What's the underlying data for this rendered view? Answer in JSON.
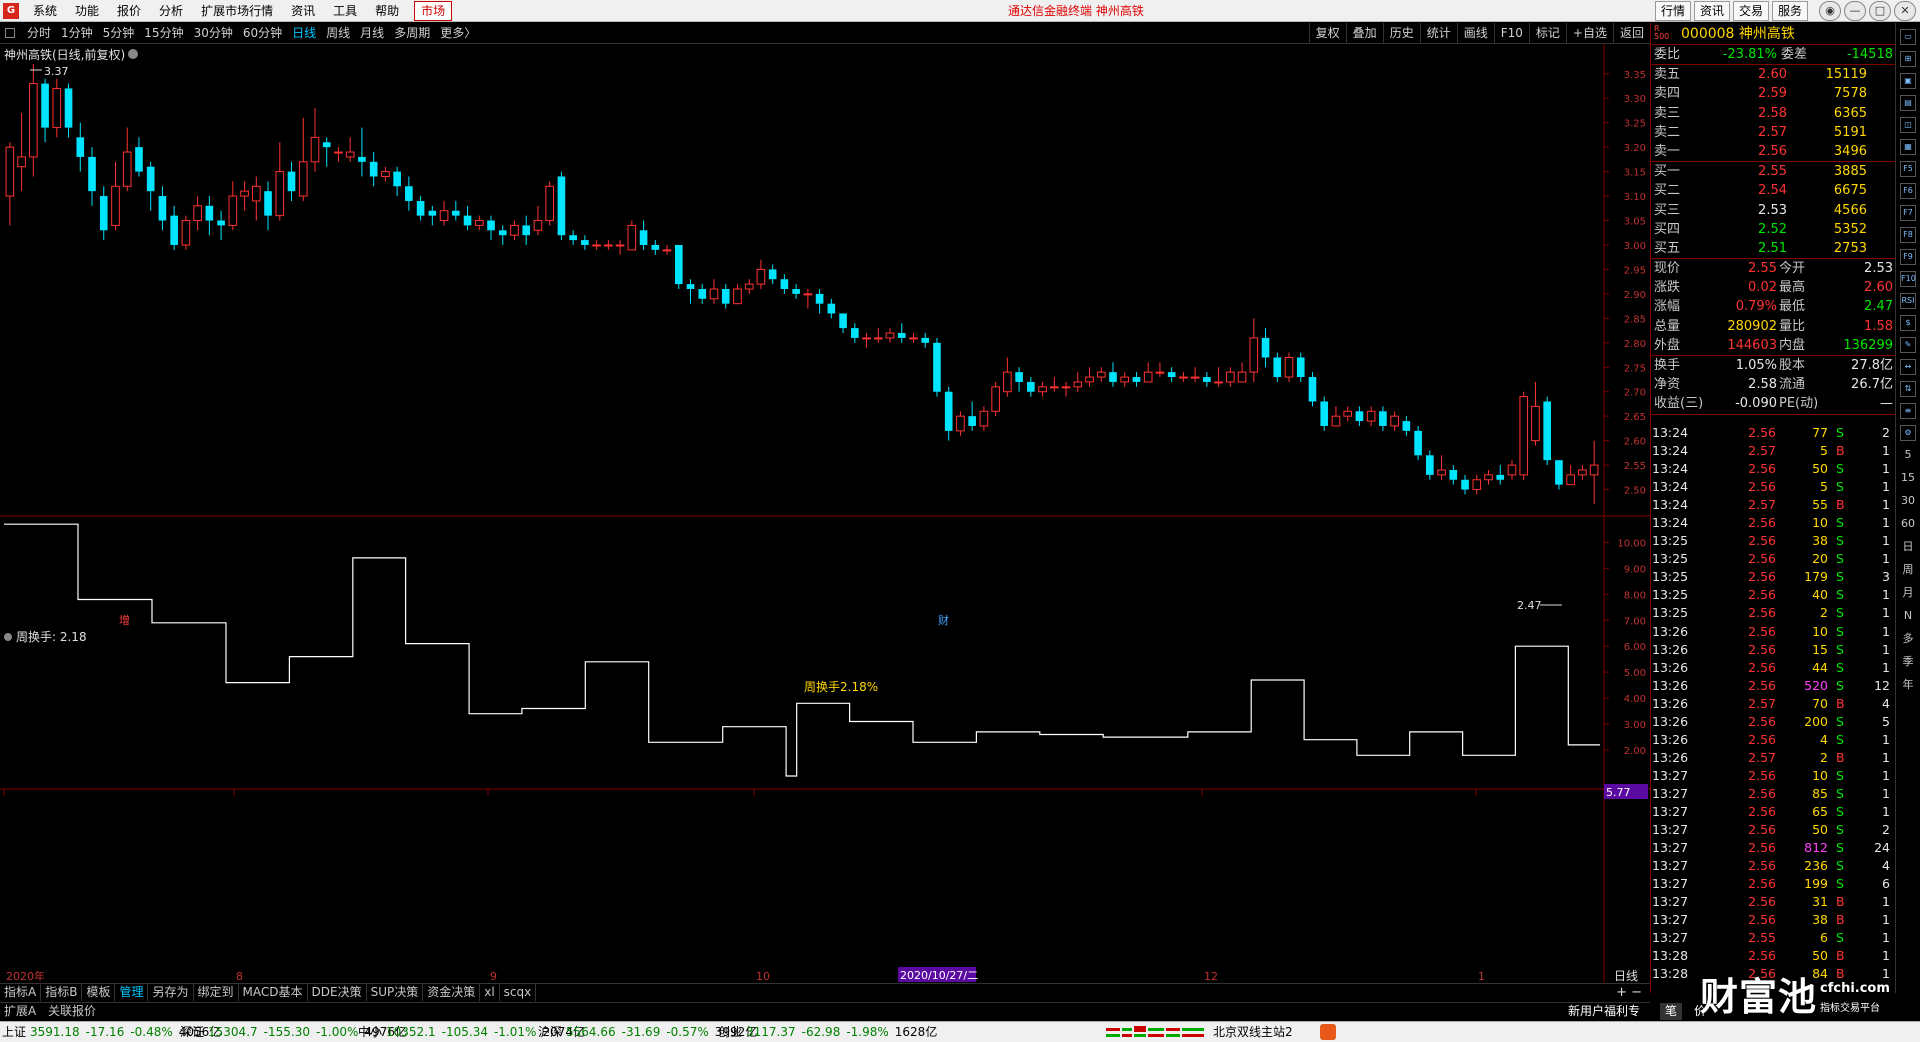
{
  "menu": {
    "logo_text": "G",
    "items": [
      "系统",
      "功能",
      "报价",
      "分析",
      "扩展市场行情",
      "资讯",
      "工具",
      "帮助"
    ],
    "market": "市场",
    "center_title": "通达信金融终端  神州高铁",
    "right_buttons": [
      "行情",
      "资讯",
      "交易",
      "服务"
    ],
    "win_buttons": [
      "◉",
      "—",
      "□",
      "✕"
    ]
  },
  "period": {
    "tabs": [
      "分时",
      "1分钟",
      "5分钟",
      "15分钟",
      "30分钟",
      "60分钟",
      "日线",
      "周线",
      "月线",
      "多周期",
      "更多〉"
    ],
    "active": "日线",
    "tools": [
      "复权",
      "叠加",
      "历史",
      "统计",
      "画线",
      "F10",
      "标记",
      "+自选",
      "返回"
    ]
  },
  "chart": {
    "title": "神州高铁(日线,前复权)",
    "y_ticks": [
      "3.35",
      "3.30",
      "3.25",
      "3.20",
      "3.15",
      "3.10",
      "3.05",
      "3.00",
      "2.95",
      "2.90",
      "2.85",
      "2.80",
      "2.75",
      "2.70",
      "2.65",
      "2.60",
      "2.55",
      "2.50"
    ],
    "high_label": "3.37",
    "low_label": "2.47",
    "marker_zeng": "增",
    "marker_cai": "财",
    "indicator_name": "周换手",
    "indicator_value_label": "周换手: 2.18",
    "indicator_center_text": "周换手2.18%",
    "ind_ticks": [
      "10.00",
      "9.00",
      "8.00",
      "7.00",
      "6.00",
      "5.00",
      "4.00",
      "3.00",
      "2.00"
    ],
    "ind_current": "5.77",
    "x_labels": [
      "2020年",
      "8",
      "9",
      "10",
      "12",
      "1"
    ],
    "x_cursor": "2020/10/27/二",
    "period_label": "日线"
  },
  "chart_data": {
    "type": "candlestick",
    "y_range": [
      2.45,
      3.37
    ],
    "candles": [
      [
        3.1,
        3.2,
        3.21,
        3.04
      ],
      [
        3.16,
        3.18,
        3.27,
        3.11
      ],
      [
        3.18,
        3.33,
        3.37,
        3.14
      ],
      [
        3.33,
        3.24,
        3.34,
        3.21
      ],
      [
        3.24,
        3.32,
        3.34,
        3.22
      ],
      [
        3.32,
        3.24,
        3.33,
        3.22
      ],
      [
        3.22,
        3.18,
        3.25,
        3.15
      ],
      [
        3.18,
        3.11,
        3.2,
        3.08
      ],
      [
        3.1,
        3.03,
        3.12,
        3.01
      ],
      [
        3.04,
        3.12,
        3.17,
        3.03
      ],
      [
        3.12,
        3.19,
        3.24,
        3.11
      ],
      [
        3.2,
        3.15,
        3.22,
        3.14
      ],
      [
        3.16,
        3.11,
        3.17,
        3.07
      ],
      [
        3.1,
        3.05,
        3.12,
        3.03
      ],
      [
        3.06,
        3.0,
        3.08,
        2.99
      ],
      [
        3.0,
        3.05,
        3.06,
        2.99
      ],
      [
        3.05,
        3.08,
        3.1,
        3.03
      ],
      [
        3.08,
        3.05,
        3.1,
        3.02
      ],
      [
        3.05,
        3.04,
        3.07,
        3.01
      ],
      [
        3.04,
        3.1,
        3.13,
        3.03
      ],
      [
        3.1,
        3.11,
        3.13,
        3.07
      ],
      [
        3.09,
        3.12,
        3.14,
        3.05
      ],
      [
        3.11,
        3.06,
        3.13,
        3.03
      ],
      [
        3.06,
        3.15,
        3.21,
        3.05
      ],
      [
        3.15,
        3.11,
        3.17,
        3.09
      ],
      [
        3.1,
        3.17,
        3.26,
        3.09
      ],
      [
        3.17,
        3.22,
        3.28,
        3.15
      ],
      [
        3.21,
        3.2,
        3.22,
        3.16
      ],
      [
        3.19,
        3.19,
        3.2,
        3.17
      ],
      [
        3.18,
        3.19,
        3.22,
        3.17
      ],
      [
        3.18,
        3.17,
        3.24,
        3.14
      ],
      [
        3.17,
        3.14,
        3.19,
        3.12
      ],
      [
        3.14,
        3.15,
        3.16,
        3.13
      ],
      [
        3.15,
        3.12,
        3.16,
        3.1
      ],
      [
        3.12,
        3.09,
        3.14,
        3.07
      ],
      [
        3.09,
        3.06,
        3.1,
        3.05
      ],
      [
        3.07,
        3.06,
        3.08,
        3.04
      ],
      [
        3.05,
        3.07,
        3.09,
        3.04
      ],
      [
        3.07,
        3.06,
        3.09,
        3.05
      ],
      [
        3.06,
        3.04,
        3.08,
        3.03
      ],
      [
        3.04,
        3.05,
        3.06,
        3.03
      ],
      [
        3.05,
        3.03,
        3.06,
        3.01
      ],
      [
        3.03,
        3.02,
        3.04,
        3.0
      ],
      [
        3.02,
        3.04,
        3.05,
        3.01
      ],
      [
        3.04,
        3.02,
        3.06,
        3.0
      ],
      [
        3.03,
        3.05,
        3.08,
        3.02
      ],
      [
        3.05,
        3.12,
        3.13,
        3.04
      ],
      [
        3.14,
        3.02,
        3.15,
        3.01
      ],
      [
        3.02,
        3.01,
        3.03,
        3.0
      ],
      [
        3.01,
        3.0,
        3.02,
        2.99
      ],
      [
        3.0,
        3.0,
        3.01,
        2.99
      ],
      [
        3.0,
        3.0,
        3.01,
        2.99
      ],
      [
        3.0,
        3.0,
        3.01,
        2.98
      ],
      [
        2.99,
        3.04,
        3.05,
        2.99
      ],
      [
        3.03,
        3.0,
        3.05,
        2.99
      ],
      [
        3.0,
        2.99,
        3.01,
        2.98
      ],
      [
        2.99,
        2.99,
        3.0,
        2.98
      ],
      [
        3.0,
        2.92,
        3.0,
        2.91
      ],
      [
        2.92,
        2.91,
        2.93,
        2.88
      ],
      [
        2.91,
        2.89,
        2.92,
        2.88
      ],
      [
        2.89,
        2.91,
        2.93,
        2.88
      ],
      [
        2.91,
        2.88,
        2.92,
        2.87
      ],
      [
        2.88,
        2.91,
        2.92,
        2.88
      ],
      [
        2.91,
        2.92,
        2.93,
        2.9
      ],
      [
        2.92,
        2.95,
        2.97,
        2.91
      ],
      [
        2.95,
        2.93,
        2.96,
        2.92
      ],
      [
        2.93,
        2.91,
        2.94,
        2.9
      ],
      [
        2.91,
        2.9,
        2.92,
        2.89
      ],
      [
        2.9,
        2.9,
        2.91,
        2.87
      ],
      [
        2.9,
        2.88,
        2.91,
        2.86
      ],
      [
        2.88,
        2.86,
        2.89,
        2.85
      ],
      [
        2.86,
        2.83,
        2.86,
        2.82
      ],
      [
        2.83,
        2.81,
        2.84,
        2.8
      ],
      [
        2.81,
        2.81,
        2.82,
        2.79
      ],
      [
        2.81,
        2.81,
        2.83,
        2.8
      ],
      [
        2.81,
        2.82,
        2.83,
        2.8
      ],
      [
        2.82,
        2.81,
        2.84,
        2.8
      ],
      [
        2.81,
        2.81,
        2.82,
        2.8
      ],
      [
        2.81,
        2.8,
        2.82,
        2.79
      ],
      [
        2.8,
        2.7,
        2.81,
        2.69
      ],
      [
        2.7,
        2.62,
        2.71,
        2.6
      ],
      [
        2.62,
        2.65,
        2.66,
        2.61
      ],
      [
        2.65,
        2.63,
        2.68,
        2.62
      ],
      [
        2.63,
        2.66,
        2.67,
        2.62
      ],
      [
        2.66,
        2.71,
        2.72,
        2.65
      ],
      [
        2.7,
        2.74,
        2.77,
        2.69
      ],
      [
        2.74,
        2.72,
        2.75,
        2.7
      ],
      [
        2.72,
        2.7,
        2.73,
        2.69
      ],
      [
        2.7,
        2.71,
        2.72,
        2.69
      ],
      [
        2.71,
        2.71,
        2.73,
        2.7
      ],
      [
        2.71,
        2.71,
        2.72,
        2.69
      ],
      [
        2.71,
        2.72,
        2.74,
        2.7
      ],
      [
        2.72,
        2.73,
        2.75,
        2.71
      ],
      [
        2.73,
        2.74,
        2.75,
        2.72
      ],
      [
        2.74,
        2.72,
        2.76,
        2.71
      ],
      [
        2.72,
        2.73,
        2.74,
        2.71
      ],
      [
        2.73,
        2.72,
        2.74,
        2.71
      ],
      [
        2.72,
        2.74,
        2.76,
        2.72
      ],
      [
        2.74,
        2.74,
        2.76,
        2.73
      ],
      [
        2.74,
        2.73,
        2.75,
        2.72
      ],
      [
        2.73,
        2.73,
        2.74,
        2.72
      ],
      [
        2.73,
        2.73,
        2.75,
        2.72
      ],
      [
        2.73,
        2.72,
        2.74,
        2.71
      ],
      [
        2.72,
        2.72,
        2.75,
        2.71
      ],
      [
        2.72,
        2.74,
        2.75,
        2.71
      ],
      [
        2.72,
        2.74,
        2.76,
        2.72
      ],
      [
        2.74,
        2.81,
        2.85,
        2.72
      ],
      [
        2.81,
        2.77,
        2.83,
        2.75
      ],
      [
        2.77,
        2.73,
        2.78,
        2.72
      ],
      [
        2.73,
        2.77,
        2.78,
        2.72
      ],
      [
        2.77,
        2.73,
        2.78,
        2.72
      ],
      [
        2.73,
        2.68,
        2.74,
        2.67
      ],
      [
        2.68,
        2.63,
        2.69,
        2.62
      ],
      [
        2.63,
        2.65,
        2.67,
        2.63
      ],
      [
        2.65,
        2.66,
        2.67,
        2.64
      ],
      [
        2.66,
        2.64,
        2.67,
        2.63
      ],
      [
        2.64,
        2.66,
        2.67,
        2.63
      ],
      [
        2.66,
        2.63,
        2.67,
        2.62
      ],
      [
        2.63,
        2.65,
        2.66,
        2.62
      ],
      [
        2.64,
        2.62,
        2.65,
        2.61
      ],
      [
        2.62,
        2.57,
        2.63,
        2.56
      ],
      [
        2.57,
        2.53,
        2.58,
        2.52
      ],
      [
        2.53,
        2.54,
        2.57,
        2.52
      ],
      [
        2.54,
        2.52,
        2.55,
        2.51
      ],
      [
        2.52,
        2.5,
        2.53,
        2.49
      ],
      [
        2.5,
        2.52,
        2.53,
        2.49
      ],
      [
        2.52,
        2.53,
        2.54,
        2.51
      ],
      [
        2.53,
        2.52,
        2.55,
        2.51
      ],
      [
        2.53,
        2.55,
        2.56,
        2.52
      ],
      [
        2.53,
        2.69,
        2.7,
        2.52
      ],
      [
        2.6,
        2.67,
        2.72,
        2.59
      ],
      [
        2.68,
        2.56,
        2.69,
        2.55
      ],
      [
        2.56,
        2.51,
        2.56,
        2.5
      ],
      [
        2.51,
        2.53,
        2.55,
        2.51
      ],
      [
        2.53,
        2.54,
        2.55,
        2.52
      ],
      [
        2.53,
        2.55,
        2.6,
        2.47
      ]
    ],
    "indicator": {
      "name": "周换手",
      "values": [
        10.7,
        10.7,
        10.7,
        10.7,
        10.7,
        10.7,
        10.7,
        7.8,
        7.8,
        7.8,
        7.8,
        7.8,
        7.8,
        7.8,
        6.9,
        6.9,
        6.9,
        6.9,
        6.9,
        6.9,
        6.9,
        4.6,
        4.6,
        4.6,
        4.6,
        4.6,
        4.6,
        5.6,
        5.6,
        5.6,
        5.6,
        5.6,
        5.6,
        9.4,
        9.4,
        9.4,
        9.4,
        9.4,
        6.1,
        6.1,
        6.1,
        6.1,
        6.1,
        6.1,
        3.4,
        3.4,
        3.4,
        3.4,
        3.4,
        3.6,
        3.6,
        3.6,
        3.6,
        3.6,
        3.6,
        5.4,
        5.4,
        5.4,
        5.4,
        5.4,
        5.4,
        2.3,
        2.3,
        2.3,
        2.3,
        2.3,
        2.3,
        2.3,
        2.9,
        2.9,
        2.9,
        2.9,
        2.9,
        2.9,
        1.0,
        3.8,
        3.8,
        3.8,
        3.8,
        3.8,
        3.1,
        3.1,
        3.1,
        3.1,
        3.1,
        3.1,
        2.3,
        2.3,
        2.3,
        2.3,
        2.3,
        2.3,
        2.7,
        2.7,
        2.7,
        2.7,
        2.7,
        2.7,
        2.6,
        2.6,
        2.6,
        2.6,
        2.6,
        2.6,
        2.5,
        2.5,
        2.5,
        2.5,
        2.5,
        2.5,
        2.5,
        2.5,
        2.7,
        2.7,
        2.7,
        2.7,
        2.7,
        2.7,
        4.7,
        4.7,
        4.7,
        4.7,
        4.7,
        2.4,
        2.4,
        2.4,
        2.4,
        2.4,
        1.8,
        1.8,
        1.8,
        1.8,
        1.8,
        2.7,
        2.7,
        2.7,
        2.7,
        2.7,
        1.8,
        1.8,
        1.8,
        1.8,
        1.8,
        6.0,
        6.0,
        6.0,
        6.0,
        6.0,
        2.2,
        2.2,
        2.2
      ]
    }
  },
  "quote": {
    "code": "000008 神州高铁",
    "wb": {
      "label1": "委比",
      "val1": "-23.81%",
      "label2": "委差",
      "val2": "-14518"
    },
    "asks": [
      {
        "l": "卖五",
        "p": "2.60",
        "v": "15119"
      },
      {
        "l": "卖四",
        "p": "2.59",
        "v": "7578"
      },
      {
        "l": "卖三",
        "p": "2.58",
        "v": "6365"
      },
      {
        "l": "卖二",
        "p": "2.57",
        "v": "5191"
      },
      {
        "l": "卖一",
        "p": "2.56",
        "v": "3496"
      }
    ],
    "bids": [
      {
        "l": "买一",
        "p": "2.55",
        "v": "3885",
        "c": "red"
      },
      {
        "l": "买二",
        "p": "2.54",
        "v": "6675",
        "c": "red"
      },
      {
        "l": "买三",
        "p": "2.53",
        "v": "4566",
        "c": "white"
      },
      {
        "l": "买四",
        "p": "2.52",
        "v": "5352",
        "c": "green"
      },
      {
        "l": "买五",
        "p": "2.51",
        "v": "2753",
        "c": "green"
      }
    ],
    "stats": [
      {
        "l1": "现价",
        "v1": "2.55",
        "c1": "red",
        "l2": "今开",
        "v2": "2.53",
        "c2": "white"
      },
      {
        "l1": "涨跌",
        "v1": "0.02",
        "c1": "red",
        "l2": "最高",
        "v2": "2.60",
        "c2": "red"
      },
      {
        "l1": "涨幅",
        "v1": "0.79%",
        "c1": "red",
        "l2": "最低",
        "v2": "2.47",
        "c2": "green"
      },
      {
        "l1": "总量",
        "v1": "280902",
        "c1": "yellow",
        "l2": "量比",
        "v2": "1.58",
        "c2": "red"
      },
      {
        "l1": "外盘",
        "v1": "144603",
        "c1": "red",
        "l2": "内盘",
        "v2": "136299",
        "c2": "green"
      }
    ],
    "stats2": [
      {
        "l1": "换手",
        "v1": "1.05%",
        "l2": "股本",
        "v2": "27.8亿"
      },
      {
        "l1": "净资",
        "v1": "2.58",
        "l2": "流通",
        "v2": "26.7亿"
      },
      {
        "l1": "收益(三)",
        "v1": "-0.090",
        "l2": "PE(动)",
        "v2": "—"
      }
    ]
  },
  "ticks": [
    [
      "13:24",
      "2.56",
      "77",
      "S",
      "2"
    ],
    [
      "13:24",
      "2.57",
      "5",
      "B",
      "1"
    ],
    [
      "13:24",
      "2.56",
      "50",
      "S",
      "1"
    ],
    [
      "13:24",
      "2.56",
      "5",
      "S",
      "1"
    ],
    [
      "13:24",
      "2.57",
      "55",
      "B",
      "1"
    ],
    [
      "13:24",
      "2.56",
      "10",
      "S",
      "1"
    ],
    [
      "13:25",
      "2.56",
      "38",
      "S",
      "1"
    ],
    [
      "13:25",
      "2.56",
      "20",
      "S",
      "1"
    ],
    [
      "13:25",
      "2.56",
      "179",
      "S",
      "3"
    ],
    [
      "13:25",
      "2.56",
      "40",
      "S",
      "1"
    ],
    [
      "13:25",
      "2.56",
      "2",
      "S",
      "1"
    ],
    [
      "13:26",
      "2.56",
      "10",
      "S",
      "1"
    ],
    [
      "13:26",
      "2.56",
      "15",
      "S",
      "1"
    ],
    [
      "13:26",
      "2.56",
      "44",
      "S",
      "1"
    ],
    [
      "13:26",
      "2.56",
      "520",
      "S",
      "12"
    ],
    [
      "13:26",
      "2.57",
      "70",
      "B",
      "4"
    ],
    [
      "13:26",
      "2.56",
      "200",
      "S",
      "5"
    ],
    [
      "13:26",
      "2.56",
      "4",
      "S",
      "1"
    ],
    [
      "13:26",
      "2.57",
      "2",
      "B",
      "1"
    ],
    [
      "13:27",
      "2.56",
      "10",
      "S",
      "1"
    ],
    [
      "13:27",
      "2.56",
      "85",
      "S",
      "1"
    ],
    [
      "13:27",
      "2.56",
      "65",
      "S",
      "1"
    ],
    [
      "13:27",
      "2.56",
      "50",
      "S",
      "2"
    ],
    [
      "13:27",
      "2.56",
      "812",
      "S",
      "24"
    ],
    [
      "13:27",
      "2.56",
      "236",
      "S",
      "4"
    ],
    [
      "13:27",
      "2.56",
      "199",
      "S",
      "6"
    ],
    [
      "13:27",
      "2.56",
      "31",
      "B",
      "1"
    ],
    [
      "13:27",
      "2.56",
      "38",
      "B",
      "1"
    ],
    [
      "13:27",
      "2.55",
      "6",
      "S",
      "1"
    ],
    [
      "13:28",
      "2.56",
      "50",
      "B",
      "1"
    ],
    [
      "13:28",
      "2.56",
      "84",
      "B",
      "1"
    ]
  ],
  "right_icons": [
    "▭",
    "⊞",
    "▣",
    "▤",
    "◫",
    "▦",
    "F5",
    "F6",
    "F7",
    "F8",
    "F9",
    "F10",
    "RSI",
    "$",
    "✎",
    "↔",
    "⇅",
    "≡",
    "⚙"
  ],
  "right_periods": [
    "5",
    "15",
    "30",
    "60",
    "日",
    "周",
    "月",
    "N",
    "多",
    "季",
    "年"
  ],
  "bottom": {
    "tabs": [
      "指标A",
      "指标B",
      "模板",
      "管理",
      "另存为",
      "绑定到",
      "MACD基本",
      "DDE决策",
      "SUP决策",
      "资金决策",
      "xl",
      "scqx"
    ],
    "active": "管理",
    "zoom": "+  −"
  },
  "subtabs": {
    "tabs": [
      "扩展A",
      "关联报价"
    ],
    "promo": "新用户福利专享",
    "pen": "笔",
    "extra": "价"
  },
  "status": {
    "indices": [
      {
        "name": "上证",
        "v": "3591.18",
        "ch": "-17.16",
        "pct": "-0.48%",
        "amt": "4056亿"
      },
      {
        "name": "深证",
        "v": "15304.7",
        "ch": "-155.30",
        "pct": "-1.00%",
        "amt": "4976亿"
      },
      {
        "name": "中小",
        "v": "10352.1",
        "ch": "-105.34",
        "pct": "-1.01%",
        "amt": "2074亿"
      },
      {
        "name": "沪深",
        "v": "5564.66",
        "ch": "-31.69",
        "pct": "-0.57%",
        "amt": "3992亿"
      },
      {
        "name": "创业",
        "v": "3117.37",
        "ch": "-62.98",
        "pct": "-1.98%",
        "amt": "1628亿"
      }
    ],
    "server": "北京双线主站2"
  },
  "watermark": {
    "big": "财富池",
    "url": "cfchi.com",
    "sub": "指标交易平台"
  },
  "colors": {
    "up": "#ff3232",
    "down": "#00e5ff",
    "line": "#ffffff",
    "grid": "#800000"
  }
}
